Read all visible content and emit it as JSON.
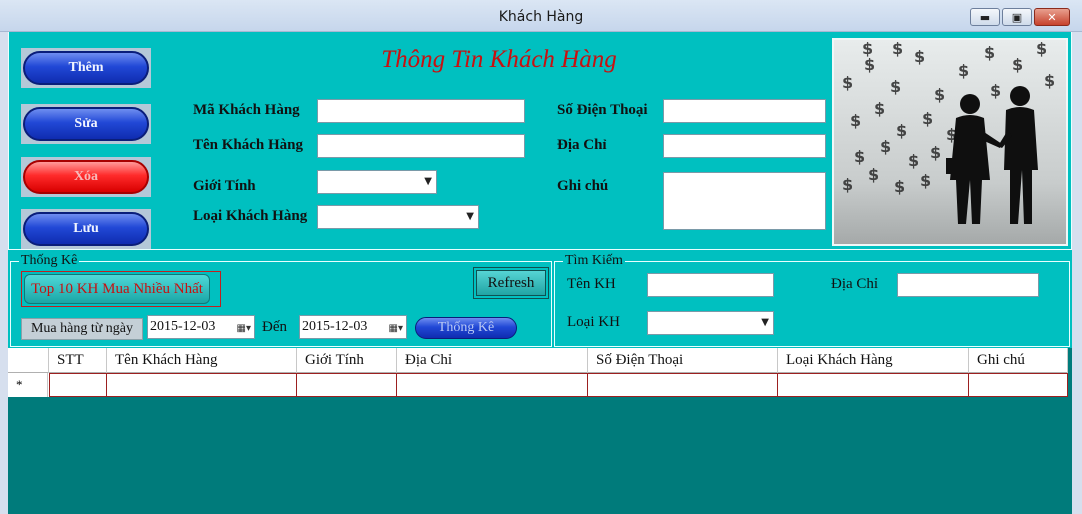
{
  "window": {
    "title": "Khách Hàng",
    "min_label": "▬",
    "max_label": "▣",
    "close_label": "✕"
  },
  "form": {
    "title": "Thông Tin Khách Hàng",
    "buttons": {
      "add": "Thêm",
      "edit": "Sửa",
      "delete": "Xóa",
      "save": "Lưu"
    },
    "fields": {
      "ma_kh_label": "Mã Khách Hàng",
      "ten_kh_label": "Tên Khách Hàng",
      "gioi_tinh_label": "Giới Tính",
      "loai_kh_label": "Loại Khách Hàng",
      "sdt_label": "Số Điện Thoại",
      "dia_chi_label": "Địa Chỉ",
      "ghi_chu_label": "Ghi chú",
      "ma_kh_value": "",
      "ten_kh_value": "",
      "gioi_tinh_value": "",
      "loai_kh_value": "",
      "sdt_value": "",
      "dia_chi_value": "",
      "ghi_chu_value": ""
    }
  },
  "thong_ke": {
    "group_title": "Thống Kê",
    "top10_label": "Top 10 KH Mua Nhiều Nhất",
    "refresh_label": "Refresh",
    "from_label": "Mua hàng từ ngày",
    "from_date": "2015-12-03",
    "to_label": "Đến",
    "to_date": "2015-12-03",
    "stat_button": "Thống Kê"
  },
  "tim_kiem": {
    "group_title": "Tìm Kiếm",
    "ten_kh_label": "Tên KH",
    "dia_chi_label": "Địa Chỉ",
    "loai_kh_label": "Loại KH",
    "ten_kh_value": "",
    "dia_chi_value": "",
    "loai_kh_value": ""
  },
  "grid": {
    "columns": [
      "STT",
      "Tên Khách Hàng",
      "Giới Tính",
      "Địa Chỉ",
      "Số Điện Thoại",
      "Loại Khách Hàng",
      "Ghi chú"
    ],
    "new_row_marker": "*"
  },
  "icons": {
    "dropdown": "chevron-down-icon",
    "calendar": "calendar-icon"
  },
  "colors": {
    "panel": "#00c0c0",
    "grid_bg": "#007b7b",
    "title_red": "#c81010",
    "button_blue": "#2148d6",
    "button_red": "#ff2a2a"
  }
}
